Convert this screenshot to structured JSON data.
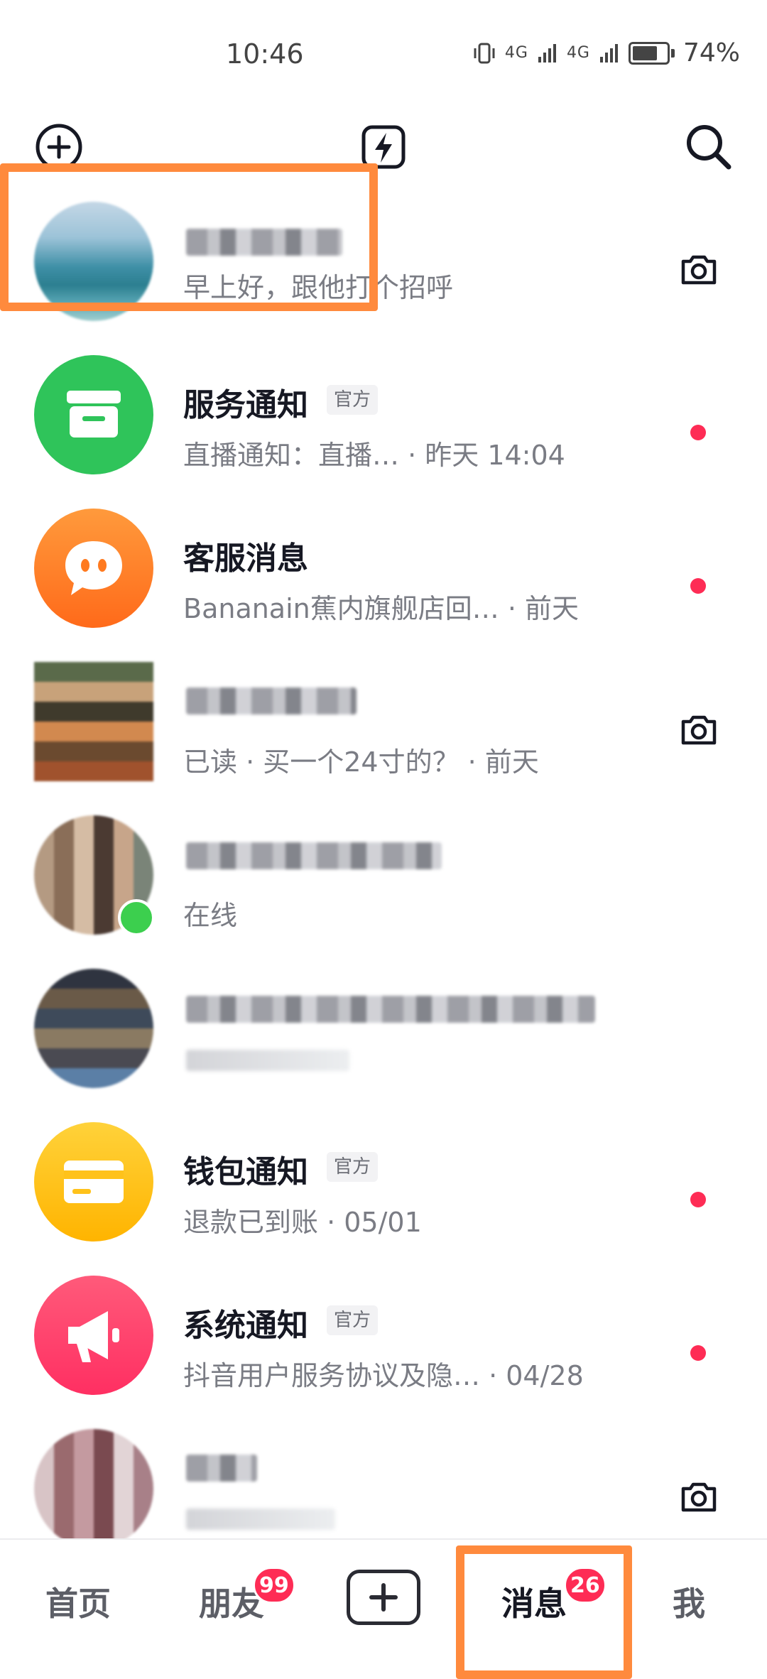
{
  "status_bar": {
    "time": "10:46",
    "signal_1": "4G",
    "signal_2": "4G",
    "battery": "74%"
  },
  "top_bar": {
    "left_icon": "add-circle-icon",
    "center_icon": "flash-icon",
    "right_icon": "search-icon"
  },
  "chats": [
    {
      "name": "",
      "subtitle": "早上好，跟他打个招呼",
      "trailing": "camera-icon"
    },
    {
      "name": "服务通知",
      "tag": "官方",
      "subtitle": "直播通知：直播…  · 昨天 14:04",
      "trailing": "unread-dot"
    },
    {
      "name": "客服消息",
      "subtitle": "Bananain蕉内旗舰店回…  · 前天",
      "trailing": "unread-dot"
    },
    {
      "name": "",
      "subtitle": "已读 · 买一个24寸的？ · 前天",
      "trailing": "camera-icon"
    },
    {
      "name": "",
      "subtitle": "在线",
      "trailing": ""
    },
    {
      "name": "",
      "subtitle": "",
      "trailing": ""
    },
    {
      "name": "钱包通知",
      "tag": "官方",
      "subtitle": "退款已到账 · 05/01",
      "trailing": "unread-dot"
    },
    {
      "name": "系统通知",
      "tag": "官方",
      "subtitle": "抖音用户服务协议及隐… · 04/28",
      "trailing": "unread-dot"
    },
    {
      "name": "",
      "subtitle": "",
      "trailing": "camera-icon"
    }
  ],
  "tab_bar": {
    "home": "首页",
    "friends": "朋友",
    "friends_badge": "99",
    "messages": "消息",
    "messages_badge": "26",
    "me": "我"
  },
  "colors": {
    "accent": "#fe2c55",
    "highlight": "#ff8a3d",
    "service_green": "#2fc45a",
    "cs_orange": "#ff7a1f",
    "wallet_yellow": "#ffc21a",
    "system_pink": "#ff3d6e"
  }
}
